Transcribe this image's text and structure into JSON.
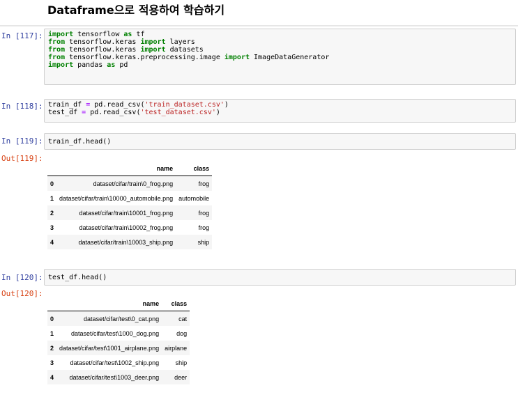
{
  "heading": "Dataframe으로 적용하여 학습하기",
  "cells": [
    {
      "prompt": "In [117]:",
      "lines": [
        [
          [
            "kw",
            "import"
          ],
          [
            "t",
            " tensorflow "
          ],
          [
            "kw",
            "as"
          ],
          [
            "t",
            " tf"
          ]
        ],
        [
          [
            "kw",
            "from"
          ],
          [
            "t",
            " tensorflow.keras "
          ],
          [
            "kw",
            "import"
          ],
          [
            "t",
            " layers"
          ]
        ],
        [
          [
            "kw",
            "from"
          ],
          [
            "t",
            " tensorflow.keras "
          ],
          [
            "kw",
            "import"
          ],
          [
            "t",
            " datasets"
          ]
        ],
        [
          [
            "kw",
            "from"
          ],
          [
            "t",
            " tensorflow.keras.preprocessing.image "
          ],
          [
            "kw",
            "import"
          ],
          [
            "t",
            " ImageDataGenerator"
          ]
        ],
        [
          [
            "kw",
            "import"
          ],
          [
            "t",
            " pandas "
          ],
          [
            "kw",
            "as"
          ],
          [
            "t",
            " pd"
          ]
        ]
      ]
    },
    {
      "prompt": "In [118]:",
      "lines": [
        [
          [
            "t",
            "train_df "
          ],
          [
            "op",
            "="
          ],
          [
            "t",
            " pd.read_csv("
          ],
          [
            "str",
            "'train_dataset.csv'"
          ],
          [
            "t",
            ")"
          ]
        ],
        [
          [
            "t",
            "test_df "
          ],
          [
            "op",
            "="
          ],
          [
            "t",
            " pd.read_csv("
          ],
          [
            "str",
            "'test_dataset.csv'"
          ],
          [
            "t",
            ")"
          ]
        ]
      ]
    },
    {
      "prompt": "In [119]:",
      "lines": [
        [
          [
            "t",
            "train_df.head()"
          ]
        ]
      ]
    },
    {
      "prompt": "In [120]:",
      "lines": [
        [
          [
            "t",
            "test_df.head()"
          ]
        ]
      ]
    }
  ],
  "outputs": [
    {
      "prompt": "Out[119]:",
      "columns": [
        "name",
        "class"
      ],
      "rows": [
        [
          "0",
          "dataset/cifar/train\\0_frog.png",
          "frog"
        ],
        [
          "1",
          "dataset/cifar/train\\10000_automobile.png",
          "automobile"
        ],
        [
          "2",
          "dataset/cifar/train\\10001_frog.png",
          "frog"
        ],
        [
          "3",
          "dataset/cifar/train\\10002_frog.png",
          "frog"
        ],
        [
          "4",
          "dataset/cifar/train\\10003_ship.png",
          "ship"
        ]
      ]
    },
    {
      "prompt": "Out[120]:",
      "columns": [
        "name",
        "class"
      ],
      "rows": [
        [
          "0",
          "dataset/cifar/test\\0_cat.png",
          "cat"
        ],
        [
          "1",
          "dataset/cifar/test\\1000_dog.png",
          "dog"
        ],
        [
          "2",
          "dataset/cifar/test\\1001_airplane.png",
          "airplane"
        ],
        [
          "3",
          "dataset/cifar/test\\1002_ship.png",
          "ship"
        ],
        [
          "4",
          "dataset/cifar/test\\1003_deer.png",
          "deer"
        ]
      ]
    }
  ],
  "colors": {
    "in_prompt": "#303f9f",
    "out_prompt": "#d84315",
    "keyword": "#008000",
    "string": "#ba2121",
    "operator": "#aa22ff"
  }
}
